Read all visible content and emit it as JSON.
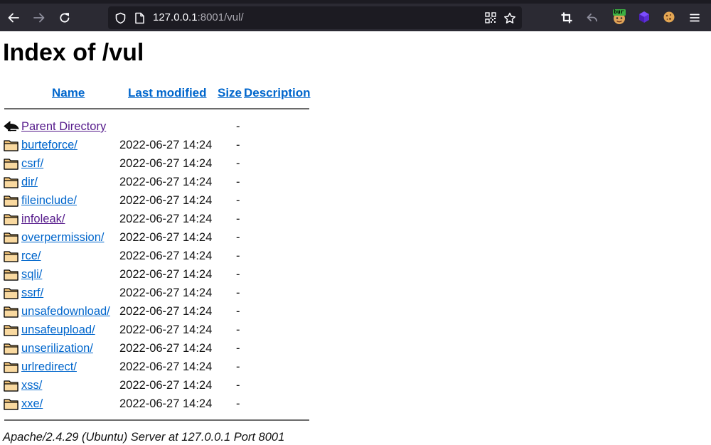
{
  "browser": {
    "url_host": "127.0.0.1",
    "url_rest": ":8001/vul/",
    "extension_badge": "bur",
    "icons": [
      "back-icon",
      "forward-icon",
      "reload-icon",
      "shield-icon",
      "page-icon",
      "qr-code-icon",
      "bookmark-star-icon",
      "crop-icon",
      "undo-icon",
      "burp-extension-icon",
      "cube-extension-icon",
      "cookie-icon",
      "menu-icon"
    ]
  },
  "page": {
    "title": "Index of /vul",
    "columns": {
      "name": "Name",
      "last_modified": "Last modified",
      "size": "Size",
      "description": "Description"
    },
    "entries": [
      {
        "name": "Parent Directory",
        "modified": "",
        "size": "-",
        "icon": "back-arrow-icon",
        "visited": true
      },
      {
        "name": "burteforce/",
        "modified": "2022-06-27 14:24",
        "size": "-",
        "icon": "folder-icon",
        "visited": false
      },
      {
        "name": "csrf/",
        "modified": "2022-06-27 14:24",
        "size": "-",
        "icon": "folder-icon",
        "visited": false
      },
      {
        "name": "dir/",
        "modified": "2022-06-27 14:24",
        "size": "-",
        "icon": "folder-icon",
        "visited": false
      },
      {
        "name": "fileinclude/",
        "modified": "2022-06-27 14:24",
        "size": "-",
        "icon": "folder-icon",
        "visited": false
      },
      {
        "name": "infoleak/",
        "modified": "2022-06-27 14:24",
        "size": "-",
        "icon": "folder-icon",
        "visited": true
      },
      {
        "name": "overpermission/",
        "modified": "2022-06-27 14:24",
        "size": "-",
        "icon": "folder-icon",
        "visited": false
      },
      {
        "name": "rce/",
        "modified": "2022-06-27 14:24",
        "size": "-",
        "icon": "folder-icon",
        "visited": false
      },
      {
        "name": "sqli/",
        "modified": "2022-06-27 14:24",
        "size": "-",
        "icon": "folder-icon",
        "visited": false
      },
      {
        "name": "ssrf/",
        "modified": "2022-06-27 14:24",
        "size": "-",
        "icon": "folder-icon",
        "visited": false
      },
      {
        "name": "unsafedownload/",
        "modified": "2022-06-27 14:24",
        "size": "-",
        "icon": "folder-icon",
        "visited": false
      },
      {
        "name": "unsafeupload/",
        "modified": "2022-06-27 14:24",
        "size": "-",
        "icon": "folder-icon",
        "visited": false
      },
      {
        "name": "unserilization/",
        "modified": "2022-06-27 14:24",
        "size": "-",
        "icon": "folder-icon",
        "visited": false
      },
      {
        "name": "urlredirect/",
        "modified": "2022-06-27 14:24",
        "size": "-",
        "icon": "folder-icon",
        "visited": false
      },
      {
        "name": "xss/",
        "modified": "2022-06-27 14:24",
        "size": "-",
        "icon": "folder-icon",
        "visited": false
      },
      {
        "name": "xxe/",
        "modified": "2022-06-27 14:24",
        "size": "-",
        "icon": "folder-icon",
        "visited": false
      }
    ],
    "footer": "Apache/2.4.29 (Ubuntu) Server at 127.0.0.1 Port 8001"
  },
  "colors": {
    "link": "#0066cc",
    "visited_link": "#551a8b",
    "toolbar_bg": "#2b2a33",
    "urlbar_bg": "#1c1b22"
  }
}
